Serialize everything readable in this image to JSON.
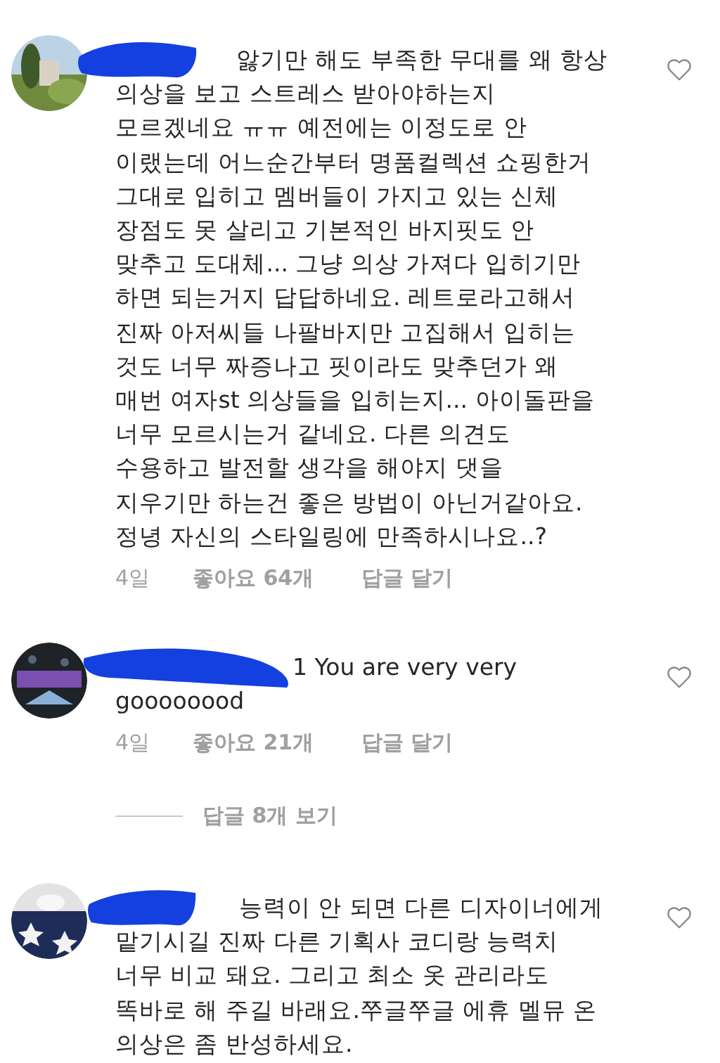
{
  "comments": [
    {
      "body": "앓기만 해도 부족한 무대를 왜 항상\n의상을 보고 스트레스 받아야하는지\n모르겠네요 ㅠㅠ 예전에는 이정도로 안\n이랬는데 어느순간부터 명품컬렉션 쇼핑한거\n그대로 입히고 멤버들이 가지고 있는 신체\n장점도 못 살리고 기본적인 바지핏도 안\n맞추고 도대체... 그냥 의상 가져다 입히기만\n하면 되는거지 답답하네요. 레트로라고해서\n진짜 아저씨들 나팔바지만 고집해서 입히는\n것도 너무 짜증나고 핏이라도 맞추던가 왜\n매번 여자st 의상들을 입히는지... 아이돌판을\n너무 모르시는거 같네요. 다른 의견도\n수용하고 발전할 생각을 해야지 댓을\n지우기만 하는건 좋은 방법이 아닌거같아요.\n정녕 자신의 스타일링에 만족하시나요..?",
      "meta": {
        "time": "4일",
        "likes": "좋아요 64개",
        "reply": "답글 달기"
      }
    },
    {
      "body": "1 You are very very\ngoooooood",
      "meta": {
        "time": "4일",
        "likes": "좋아요 21개",
        "reply": "답글 달기"
      },
      "replies_link": "답글 8개 보기"
    },
    {
      "body": "능력이 안 되면 다른 디자이너에게\n맡기시길 진짜 다른 기획사 코디랑 능력치\n너무 비교 돼요. 그리고 최소 옷 관리라도\n똑바로 해 주길 바래요.쭈글쭈글 에휴 멜뮤 온\n의상은 좀 반성하세요."
    }
  ]
}
